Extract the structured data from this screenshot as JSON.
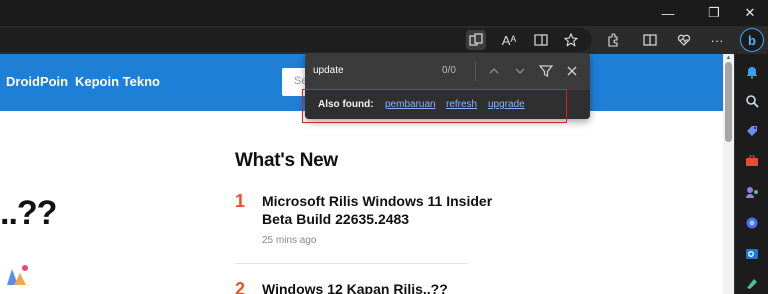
{
  "browser": {
    "window_controls": {
      "minimize_glyph": "—",
      "restore_glyph": "❐",
      "close_glyph": "✕"
    },
    "toolbar_icons": [
      "app-available-icon",
      "read-aloud-icon",
      "immersive-reader-icon",
      "favorite-star-icon",
      "extensions-icon",
      "split-screen-icon",
      "browser-essentials-icon",
      "more-menu-icon",
      "bing-copilot-icon"
    ],
    "toolbar_glyphs": {
      "read_aloud": "Aᴬ",
      "more": "···",
      "bing": "b"
    }
  },
  "site": {
    "nav": {
      "link1": "DroidPoin",
      "link2": "Kepoin Tekno",
      "search_placeholder": "Se"
    },
    "headline_fragment": "..??",
    "whats_new": {
      "heading": "What's New",
      "items": [
        {
          "number": "1",
          "title": "Microsoft Rilis Windows 11 Insider Beta Build 22635.2483",
          "time": "25 mins ago"
        },
        {
          "number": "2",
          "title": "Windows 12 Kapan Rilis..??"
        }
      ]
    },
    "brand_color": "#1e7fd6",
    "accent_color": "#e8532a"
  },
  "find_bar": {
    "query": "update",
    "count": "0/0",
    "also_found_label": "Also found:",
    "suggestions": [
      "pembaruan",
      "refresh",
      "upgrade"
    ],
    "highlight_color": "#e02020"
  },
  "sidebar_icons": [
    "notifications-icon",
    "search-icon",
    "shopping-icon",
    "tools-icon",
    "games-icon",
    "copilot-icon",
    "outlook-icon",
    "drop-icon"
  ]
}
